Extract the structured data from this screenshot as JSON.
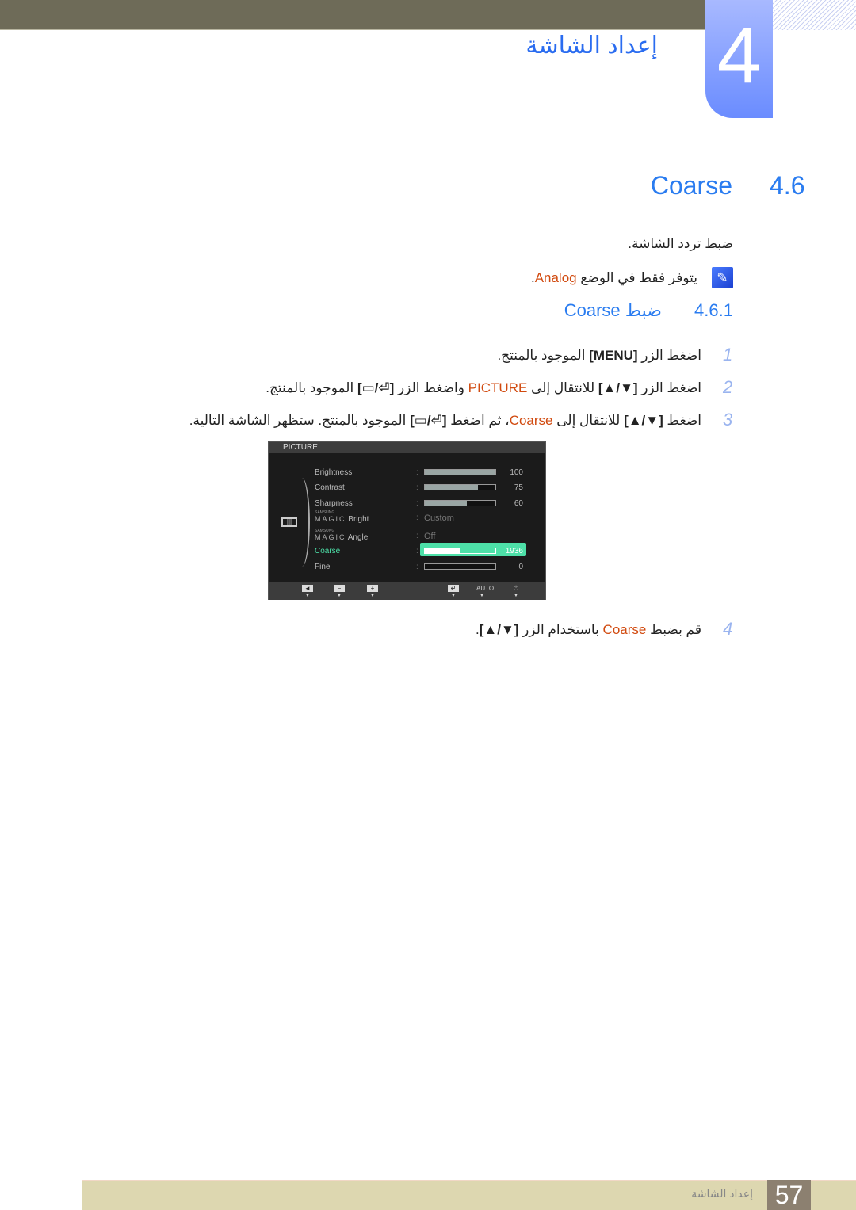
{
  "header": {
    "chapter_number": "4",
    "chapter_title": "إعداد الشاشة"
  },
  "section": {
    "number": "4.6",
    "title": "Coarse"
  },
  "description": "ضبط تردد الشاشة.",
  "note": {
    "icon": "note-pencil-icon",
    "segments": [
      {
        "t": "يتوفر فقط في الوضع "
      },
      {
        "t": "Analog",
        "s": "orange"
      },
      {
        "t": "."
      }
    ]
  },
  "subsection": {
    "number": "4.6.1",
    "title": "ضبط Coarse"
  },
  "steps": [
    {
      "num": "1",
      "segments": [
        {
          "t": "اضغط الزر "
        },
        {
          "t": "[MENU]",
          "s": "bold"
        },
        {
          "t": " الموجود بالمنتج."
        }
      ]
    },
    {
      "num": "2",
      "segments": [
        {
          "t": "اضغط الزر "
        },
        {
          "t": "[▼/▲]",
          "s": "bold"
        },
        {
          "t": " للانتقال إلى "
        },
        {
          "t": "PICTURE",
          "s": "orange"
        },
        {
          "t": " واضغط الزر "
        },
        {
          "t": "[⏎/▭]",
          "s": "bold"
        },
        {
          "t": " الموجود بالمنتج."
        }
      ]
    },
    {
      "num": "3",
      "segments": [
        {
          "t": "اضغط "
        },
        {
          "t": "[▼/▲]",
          "s": "bold"
        },
        {
          "t": " للانتقال إلى "
        },
        {
          "t": "Coarse",
          "s": "orange"
        },
        {
          "t": "، ثم اضغط "
        },
        {
          "t": "[⏎/▭]",
          "s": "bold"
        },
        {
          "t": " الموجود بالمنتج. ستظهر الشاشة التالية."
        }
      ]
    },
    {
      "num": "4",
      "segments": [
        {
          "t": "قم بضبط "
        },
        {
          "t": "Coarse",
          "s": "orange"
        },
        {
          "t": " باستخدام الزر "
        },
        {
          "t": "[▼/▲]",
          "s": "bold"
        },
        {
          "t": "."
        }
      ]
    }
  ],
  "osd": {
    "title": "PICTURE",
    "rows": [
      {
        "label": "Brightness",
        "value": "100",
        "level": 100
      },
      {
        "label": "Contrast",
        "value": "75",
        "level": 75
      },
      {
        "label": "Sharpness",
        "value": "60",
        "level": 60
      },
      {
        "brand": "SAMSUNG",
        "magic": "MAGIC",
        "label": "Bright",
        "value": "Custom"
      },
      {
        "brand": "SAMSUNG",
        "magic": "MAGIC",
        "label": "Angle",
        "value": "Off"
      },
      {
        "label": "Coarse",
        "value": "1936",
        "level": 50,
        "selected": true
      },
      {
        "label": "Fine",
        "value": "0",
        "level": 0
      }
    ],
    "footer_buttons": [
      {
        "icon": "left-arrow-icon",
        "glyph": "◄"
      },
      {
        "icon": "minus-icon",
        "glyph": "−"
      },
      {
        "icon": "plus-icon",
        "glyph": "+"
      },
      {
        "icon": "enter-icon",
        "glyph": "↵"
      },
      {
        "label": "AUTO"
      },
      {
        "icon": "power-icon",
        "glyph": "⏻"
      }
    ],
    "accent": "#4de0a8"
  },
  "footer": {
    "page": "57",
    "chapter_title": "إعداد الشاشة"
  }
}
